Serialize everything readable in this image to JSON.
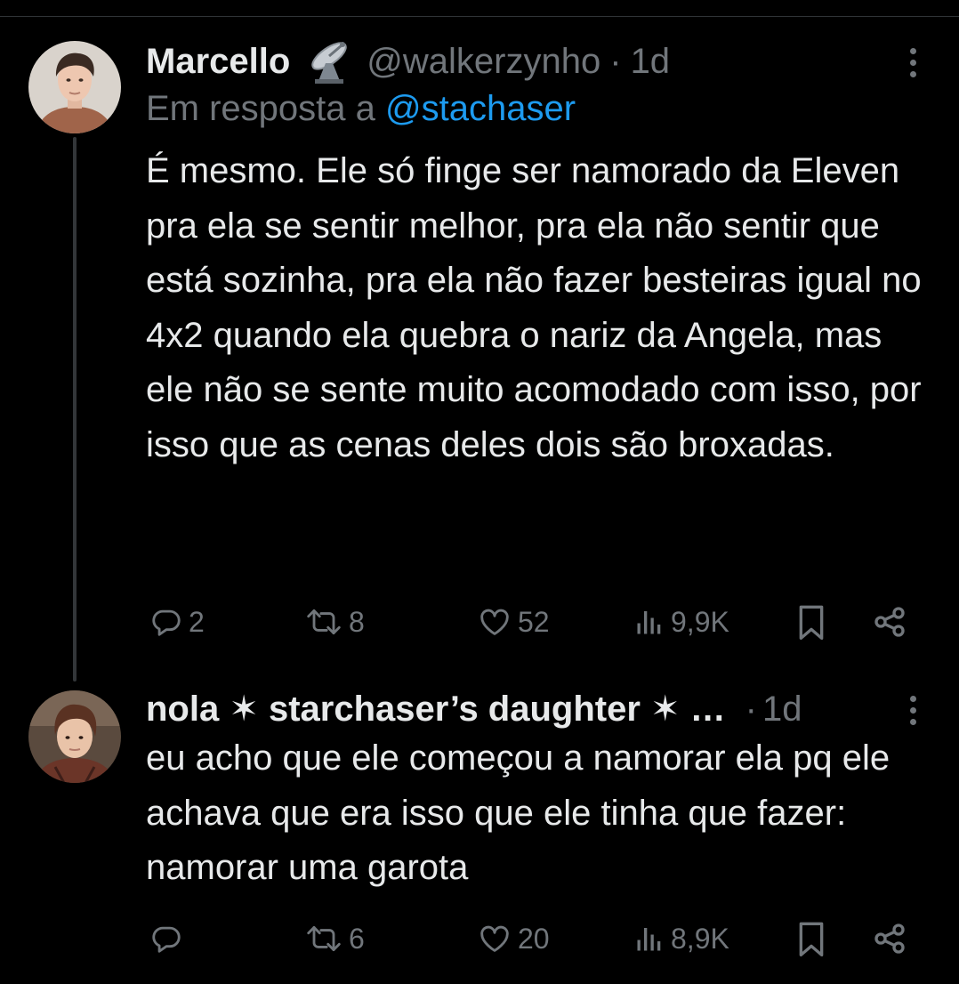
{
  "tweets": [
    {
      "name": "Marcello",
      "badge_icon": "satellite-dish-emoji",
      "handle": "@walkerzynho",
      "separator": "·",
      "time": "1d",
      "reply_prefix": "Em resposta a",
      "reply_to": "@stachaser",
      "text": "É mesmo. Ele só finge ser namorado da Eleven pra ela se sentir melhor, pra ela não sentir que está sozinha, pra ela não fazer besteiras igual no 4x2 quando ela quebra o nariz da Angela, mas ele não se sente muito acomodado com isso, por isso que as cenas deles dois são broxadas.",
      "stats": {
        "replies": "2",
        "retweets": "8",
        "likes": "52",
        "views": "9,9K"
      }
    },
    {
      "name": "nola ✶ starchaser’s daughter ✶ …",
      "separator": "·",
      "time": "1d",
      "text": "eu acho que ele começou a namorar ela pq ele achava que era isso que ele tinha que fazer: namorar uma garota",
      "stats": {
        "replies": "",
        "retweets": "6",
        "likes": "20",
        "views": "8,9K"
      }
    }
  ],
  "colors": {
    "background": "#000000",
    "text": "#e7e9ea",
    "secondary": "#71767b",
    "link": "#1d9bf0",
    "thread_line": "#333639"
  },
  "icons": [
    "reply-icon",
    "retweet-icon",
    "like-icon",
    "views-icon",
    "bookmark-icon",
    "share-icon",
    "more-icon"
  ]
}
